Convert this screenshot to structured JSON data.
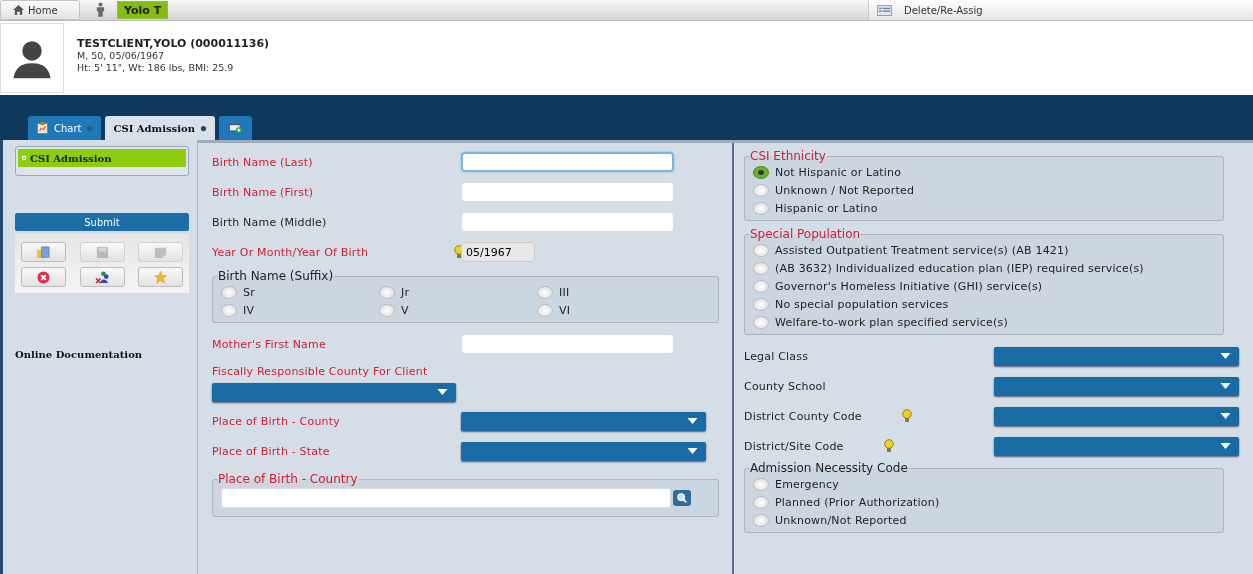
{
  "top_bar": {
    "home_tab": {
      "label": "Home",
      "selected": false
    },
    "patient_tab": {
      "label": "Yolo T",
      "selected": true
    },
    "task_tab": {
      "label": "Delete/Re-Assig",
      "selected": false
    }
  },
  "patient": {
    "name": "TESTCLIENT,YOLO (000011136)",
    "demographics": "M, 50, 05/06/1967",
    "vitals": "Ht: 5' 11\", Wt: 186 lbs, BMI: 25.9"
  },
  "tabs": [
    {
      "kind": "chart",
      "label": "Chart",
      "selected": false
    },
    {
      "kind": "form",
      "label": "CSI Admission",
      "selected": true
    },
    {
      "kind": "add",
      "selected": false
    }
  ],
  "sidebar": {
    "items": [
      {
        "label": "CSI Admission",
        "selected": true
      }
    ],
    "submit": "Submit",
    "tools": [
      {
        "kind": "documents",
        "disabled": false
      },
      {
        "kind": "save",
        "disabled": true
      },
      {
        "kind": "note",
        "disabled": true
      },
      {
        "kind": "cancel",
        "disabled": false
      },
      {
        "kind": "people",
        "disabled": false
      },
      {
        "kind": "star",
        "disabled": false
      }
    ],
    "link": "Online Documentation"
  },
  "form": {
    "left": [
      {
        "kind": "text",
        "label": "Birth Name (Last)",
        "required": true,
        "focused": true,
        "hint": false,
        "disabled": false
      },
      {
        "kind": "text",
        "label": "Birth Name (First)",
        "required": true,
        "focused": false,
        "hint": false,
        "disabled": false
      },
      {
        "kind": "text",
        "label": "Birth Name (Middle)",
        "required": false,
        "focused": false,
        "hint": false,
        "disabled": false
      },
      {
        "kind": "text",
        "label": "Year Or Month/Year Of Birth",
        "required": true,
        "focused": false,
        "hint": true,
        "disabled": true,
        "value": "05/1967"
      },
      {
        "kind": "radio-grid",
        "legend": "Birth Name (Suffix)",
        "required": false,
        "options": [
          {
            "label": "Sr",
            "selected": false
          },
          {
            "label": "Jr",
            "selected": false
          },
          {
            "label": "III",
            "selected": false
          },
          {
            "label": "IV",
            "selected": false
          },
          {
            "label": "V",
            "selected": false
          },
          {
            "label": "VI",
            "selected": false
          }
        ]
      },
      {
        "kind": "text",
        "label": "Mother's First Name",
        "required": true,
        "focused": false,
        "hint": false,
        "disabled": false
      },
      {
        "kind": "dropdown-below",
        "label": "Fiscally Responsible County For Client",
        "required": true,
        "hint": false
      },
      {
        "kind": "dropdown",
        "label": "Place of Birth - County",
        "required": true,
        "hint": false
      },
      {
        "kind": "dropdown",
        "label": "Place of Birth - State",
        "required": true,
        "hint": false
      },
      {
        "kind": "lookup",
        "legend": "Place of Birth - Country",
        "required": true
      }
    ],
    "right": [
      {
        "kind": "radio-list",
        "legend": "CSI Ethnicity",
        "required": true,
        "options": [
          {
            "label": "Not Hispanic or Latino",
            "selected": true
          },
          {
            "label": "Unknown / Not Reported",
            "selected": false
          },
          {
            "label": "Hispanic or Latino",
            "selected": false
          }
        ]
      },
      {
        "kind": "radio-list",
        "legend": "Special Population",
        "required": true,
        "options": [
          {
            "label": "Assisted Outpatient Treatment service(s) (AB 1421)",
            "selected": false
          },
          {
            "label": "(AB 3632) Individualized education plan (IEP) required service(s)",
            "selected": false
          },
          {
            "label": "Governor's Homeless Initiative (GHI) service(s)",
            "selected": false
          },
          {
            "label": "No special population services",
            "selected": false
          },
          {
            "label": "Welfare-to-work plan specified service(s)",
            "selected": false
          }
        ]
      },
      {
        "kind": "dropdown",
        "label": "Legal Class",
        "required": false,
        "hint": false
      },
      {
        "kind": "dropdown",
        "label": "County School",
        "required": false,
        "hint": false
      },
      {
        "kind": "dropdown",
        "label": "District County Code",
        "required": false,
        "hint": true
      },
      {
        "kind": "dropdown",
        "label": "District/Site Code",
        "required": false,
        "hint": true
      },
      {
        "kind": "radio-list",
        "legend": "Admission Necessity Code",
        "required": false,
        "options": [
          {
            "label": "Emergency",
            "selected": false
          },
          {
            "label": "Planned (Prior Authorization)",
            "selected": false
          },
          {
            "label": "Unknown/Not Reported",
            "selected": false
          }
        ]
      }
    ]
  }
}
